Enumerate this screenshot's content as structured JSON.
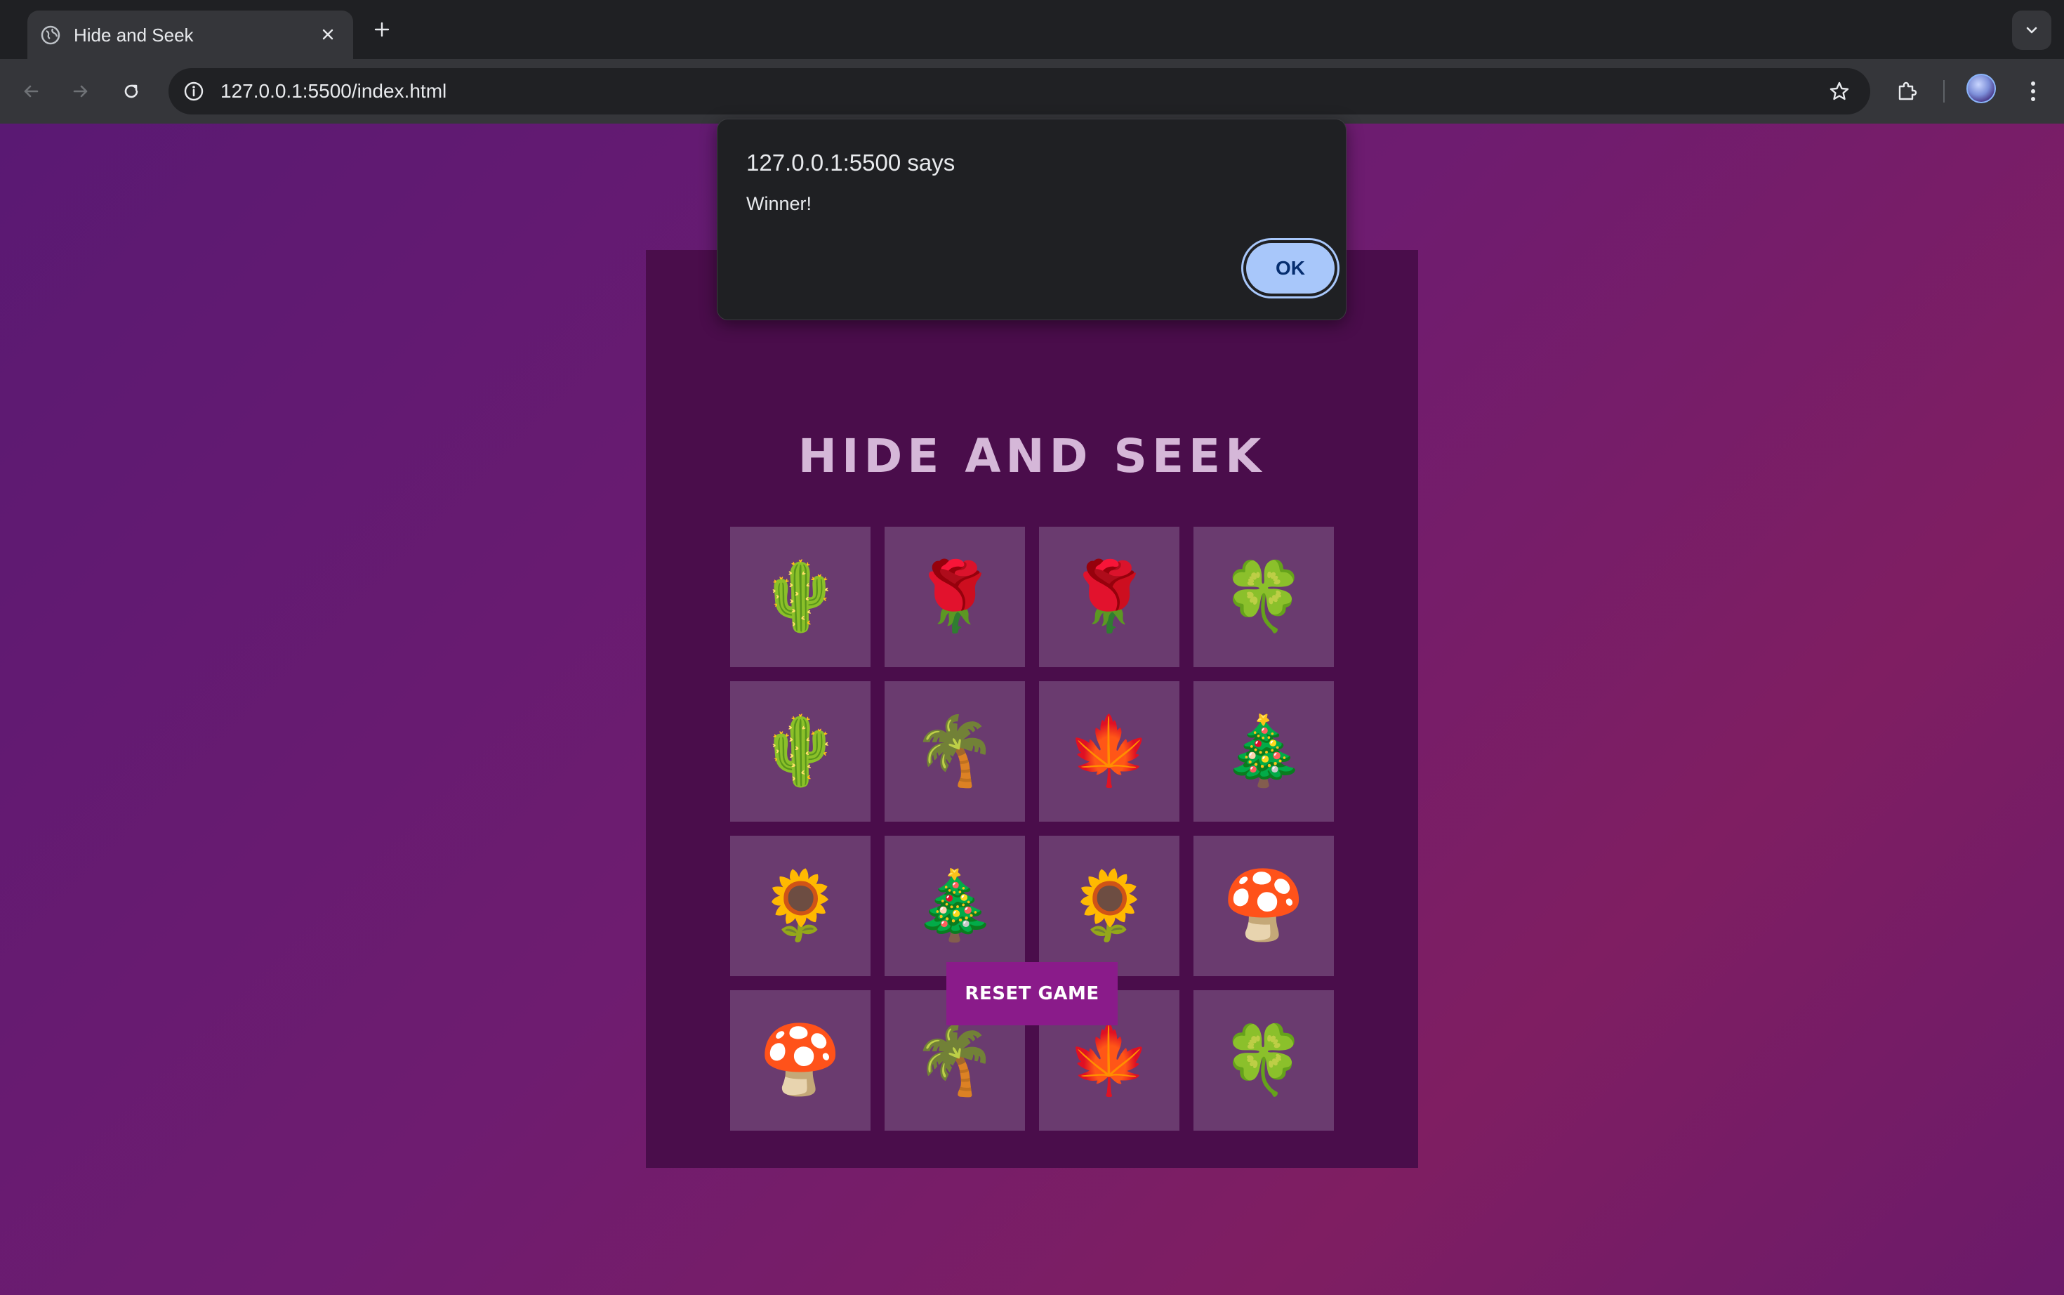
{
  "browser": {
    "tab_title": "Hide and Seek",
    "url": "127.0.0.1:5500/index.html"
  },
  "dialog": {
    "title": "127.0.0.1:5500 says",
    "message": "Winner!",
    "ok_label": "OK"
  },
  "game": {
    "title": "HIDE AND SEEK",
    "reset_label": "RESET GAME",
    "cards": [
      {
        "emoji": "🌵",
        "icon": "cactus-icon"
      },
      {
        "emoji": "🌹",
        "icon": "rose-icon"
      },
      {
        "emoji": "🌹",
        "icon": "rose-icon"
      },
      {
        "emoji": "🍀",
        "icon": "four-leaf-clover-icon"
      },
      {
        "emoji": "🌵",
        "icon": "cactus-icon"
      },
      {
        "emoji": "🌴",
        "icon": "palm-tree-icon"
      },
      {
        "emoji": "🍁",
        "icon": "maple-leaf-icon"
      },
      {
        "emoji": "🎄",
        "icon": "christmas-tree-icon"
      },
      {
        "emoji": "🌻",
        "icon": "sunflower-icon"
      },
      {
        "emoji": "🎄",
        "icon": "christmas-tree-icon"
      },
      {
        "emoji": "🌻",
        "icon": "sunflower-icon"
      },
      {
        "emoji": "🍄",
        "icon": "mushroom-icon"
      },
      {
        "emoji": "🍄",
        "icon": "mushroom-icon"
      },
      {
        "emoji": "🌴",
        "icon": "palm-tree-icon"
      },
      {
        "emoji": "🍁",
        "icon": "maple-leaf-icon"
      },
      {
        "emoji": "🍀",
        "icon": "four-leaf-clover-icon"
      }
    ]
  }
}
